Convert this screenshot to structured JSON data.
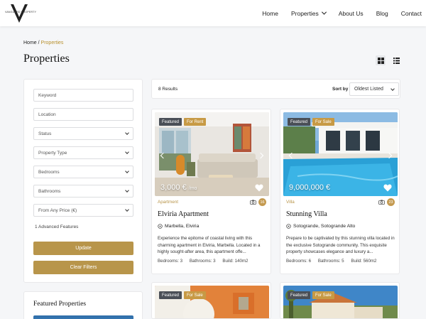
{
  "brand": {
    "logo_text": "VANGUARD PROPERTY"
  },
  "nav": {
    "home": "Home",
    "properties": "Properties",
    "about": "About Us",
    "blog": "Blog",
    "contact": "Contact"
  },
  "breadcrumb": {
    "home": "Home",
    "separator": " / ",
    "current": "Properties"
  },
  "page_title": "Properties",
  "filters": {
    "keyword_placeholder": "Keyword",
    "location_placeholder": "Location",
    "status": "Status",
    "property_type": "Property Type",
    "bedrooms": "Bedrooms",
    "bathrooms": "Bathrooms",
    "price": "From Any Price (€)",
    "advanced": "1 Advanced Features",
    "update_label": "Update",
    "clear_label": "Clear Filters"
  },
  "featured": {
    "title": "Featured Properties"
  },
  "results": {
    "count": "8 Results",
    "sort_label": "Sort by",
    "sort_value": "Oldest Listed"
  },
  "cards": [
    {
      "featured": "Featured",
      "status": "For Rent",
      "price": "3,000 €",
      "price_suffix": "/mo",
      "category": "Apartment",
      "photos": "16",
      "title": "Elviria Apartment",
      "location": "Marbella, Elviria",
      "description": "Experience the epitome of coastal living with this charming apartment in Elviria, Marbella. Located in a highly sought-after area, this apartment offe...",
      "bedrooms": "Bedrooms: 3",
      "bathrooms": "Bathrooms: 3",
      "build": "Build: 140m2"
    },
    {
      "featured": "Featured",
      "status": "For Sale",
      "price": "9,000,000 €",
      "price_suffix": "",
      "category": "Villa",
      "photos": "23",
      "title": "Stunning Villa",
      "location": "Sotogrande, Sotogrande Alto",
      "description": "Prepare to be captivated by this stunning villa located in the exclusive Sotogrande community. This exquisite property showcases elegance and luxury a...",
      "bedrooms": "Bedrooms: 6",
      "bathrooms": "Bathrooms: 5",
      "build": "Build: 560m2"
    },
    {
      "featured": "Featured",
      "status": "For Sale"
    },
    {
      "featured": "Featured",
      "status": "For Sale"
    }
  ],
  "colors": {
    "accent": "#b8954a",
    "badge_dark": "#4a4f57",
    "badge_gold": "#c79a45"
  }
}
